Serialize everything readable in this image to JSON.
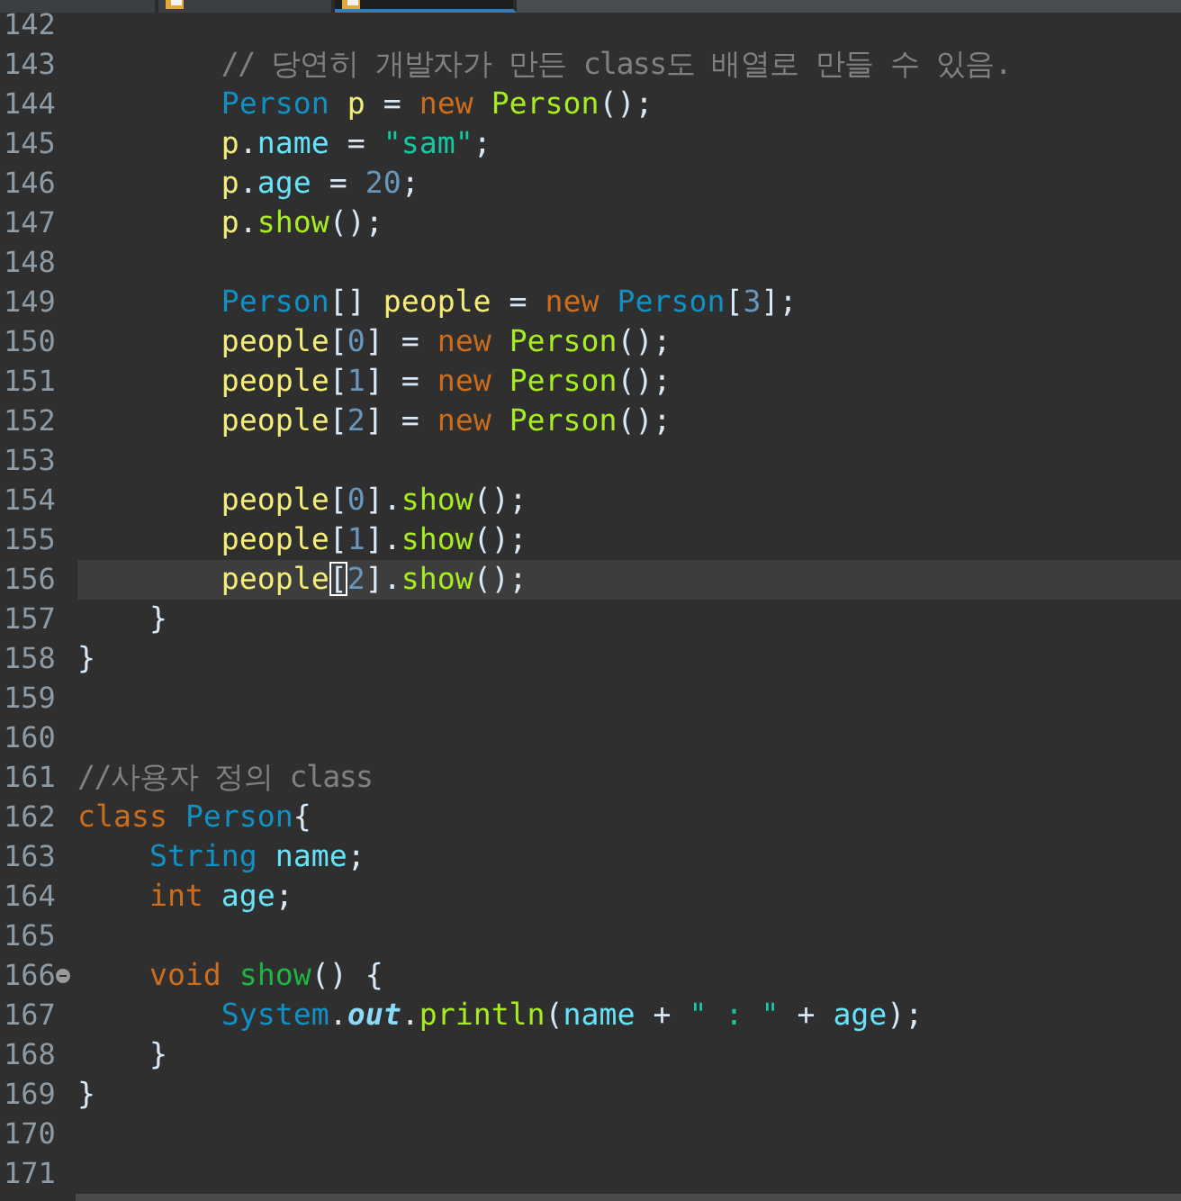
{
  "tabs": [
    {
      "selected": false
    },
    {
      "selected": false
    },
    {
      "selected": true
    }
  ],
  "lines": [
    {
      "number": "142",
      "current": false,
      "fold": false
    },
    {
      "number": "143",
      "current": false,
      "fold": false,
      "kind": "method",
      "tokens": [
        {
          "kind": "comment",
          "text": "// 당연히 개발자가 만든 class도 배열로 만들 수 있음."
        }
      ]
    },
    {
      "number": "144",
      "current": false,
      "fold": false,
      "kind": "method",
      "tokens": [
        {
          "kind": "type",
          "text": "Person"
        },
        {
          "kind": "local",
          "text": " p"
        },
        {
          "kind": "plain",
          "text": " = "
        },
        {
          "kind": "keyword",
          "text": "new"
        },
        {
          "kind": "method",
          "text": " Person"
        },
        {
          "kind": "plain",
          "text": "();"
        }
      ]
    },
    {
      "number": "145",
      "current": false,
      "fold": false,
      "kind": "method",
      "tokens": [
        {
          "kind": "local",
          "text": "p"
        },
        {
          "kind": "plain",
          "text": "."
        },
        {
          "kind": "field",
          "text": "name"
        },
        {
          "kind": "plain",
          "text": " = "
        },
        {
          "kind": "string",
          "text": "\"sam\""
        },
        {
          "kind": "plain",
          "text": ";"
        }
      ]
    },
    {
      "number": "146",
      "current": false,
      "fold": false,
      "kind": "method",
      "tokens": [
        {
          "kind": "local",
          "text": "p"
        },
        {
          "kind": "plain",
          "text": "."
        },
        {
          "kind": "field",
          "text": "age"
        },
        {
          "kind": "plain",
          "text": " = "
        },
        {
          "kind": "number",
          "text": "20"
        },
        {
          "kind": "plain",
          "text": ";"
        }
      ]
    },
    {
      "number": "147",
      "current": false,
      "fold": false,
      "kind": "method",
      "tokens": [
        {
          "kind": "local",
          "text": "p"
        },
        {
          "kind": "plain",
          "text": "."
        },
        {
          "kind": "method",
          "text": "show"
        },
        {
          "kind": "plain",
          "text": "();"
        }
      ]
    },
    {
      "number": "148",
      "current": false,
      "fold": false
    },
    {
      "number": "149",
      "current": false,
      "fold": false,
      "kind": "method",
      "tokens": [
        {
          "kind": "type",
          "text": "Person"
        },
        {
          "kind": "plain",
          "text": "[]"
        },
        {
          "kind": "local",
          "text": " people"
        },
        {
          "kind": "plain",
          "text": " = "
        },
        {
          "kind": "keyword",
          "text": "new"
        },
        {
          "kind": "type",
          "text": " Person"
        },
        {
          "kind": "plain",
          "text": "["
        },
        {
          "kind": "number",
          "text": "3"
        },
        {
          "kind": "plain",
          "text": "];"
        }
      ]
    },
    {
      "number": "150",
      "current": false,
      "fold": false,
      "kind": "method",
      "tokens": [
        {
          "kind": "local",
          "text": "people"
        },
        {
          "kind": "plain",
          "text": "["
        },
        {
          "kind": "number",
          "text": "0"
        },
        {
          "kind": "plain",
          "text": "] = "
        },
        {
          "kind": "keyword",
          "text": "new"
        },
        {
          "kind": "method",
          "text": " Person"
        },
        {
          "kind": "plain",
          "text": "();"
        }
      ]
    },
    {
      "number": "151",
      "current": false,
      "fold": false,
      "kind": "method",
      "tokens": [
        {
          "kind": "local",
          "text": "people"
        },
        {
          "kind": "plain",
          "text": "["
        },
        {
          "kind": "number",
          "text": "1"
        },
        {
          "kind": "plain",
          "text": "] = "
        },
        {
          "kind": "keyword",
          "text": "new"
        },
        {
          "kind": "method",
          "text": " Person"
        },
        {
          "kind": "plain",
          "text": "();"
        }
      ]
    },
    {
      "number": "152",
      "current": false,
      "fold": false,
      "kind": "method",
      "tokens": [
        {
          "kind": "local",
          "text": "people"
        },
        {
          "kind": "plain",
          "text": "["
        },
        {
          "kind": "number",
          "text": "2"
        },
        {
          "kind": "plain",
          "text": "] = "
        },
        {
          "kind": "keyword",
          "text": "new"
        },
        {
          "kind": "method",
          "text": " Person"
        },
        {
          "kind": "plain",
          "text": "();"
        }
      ]
    },
    {
      "number": "153",
      "current": false,
      "fold": false
    },
    {
      "number": "154",
      "current": false,
      "fold": false,
      "kind": "method",
      "tokens": [
        {
          "kind": "local",
          "text": "people"
        },
        {
          "kind": "plain",
          "text": "["
        },
        {
          "kind": "number",
          "text": "0"
        },
        {
          "kind": "plain",
          "text": "]."
        },
        {
          "kind": "method",
          "text": "show"
        },
        {
          "kind": "plain",
          "text": "();"
        }
      ]
    },
    {
      "number": "155",
      "current": false,
      "fold": false,
      "kind": "method",
      "tokens": [
        {
          "kind": "local",
          "text": "people"
        },
        {
          "kind": "plain",
          "text": "["
        },
        {
          "kind": "number",
          "text": "1"
        },
        {
          "kind": "plain",
          "text": "]."
        },
        {
          "kind": "method",
          "text": "show"
        },
        {
          "kind": "plain",
          "text": "();"
        }
      ]
    },
    {
      "number": "156",
      "current": true,
      "fold": false,
      "kind": "method",
      "tokens": [
        {
          "kind": "local",
          "text": "people"
        },
        {
          "kind": "plain",
          "text": "[",
          "caret": true
        },
        {
          "kind": "number",
          "text": "2"
        },
        {
          "kind": "plain",
          "text": "]."
        },
        {
          "kind": "method",
          "text": "show"
        },
        {
          "kind": "plain",
          "text": "();"
        }
      ]
    },
    {
      "number": "157",
      "current": false,
      "fold": false,
      "kind": "class",
      "tokens": [
        {
          "kind": "plain",
          "text": "}"
        }
      ]
    },
    {
      "number": "158",
      "current": false,
      "fold": false,
      "tokens": [
        {
          "kind": "plain",
          "text": "}"
        }
      ]
    },
    {
      "number": "159",
      "current": false,
      "fold": false
    },
    {
      "number": "160",
      "current": false,
      "fold": false
    },
    {
      "number": "161",
      "current": false,
      "fold": false,
      "tokens": [
        {
          "kind": "comment",
          "text": "//사용자 정의 class"
        }
      ]
    },
    {
      "number": "162",
      "current": false,
      "fold": false,
      "tokens": [
        {
          "kind": "keyword",
          "text": "class"
        },
        {
          "kind": "type",
          "text": " Person"
        },
        {
          "kind": "plain",
          "text": "{"
        }
      ]
    },
    {
      "number": "163",
      "current": false,
      "fold": false,
      "kind": "class",
      "tokens": [
        {
          "kind": "type",
          "text": "String"
        },
        {
          "kind": "field",
          "text": " name"
        },
        {
          "kind": "plain",
          "text": ";"
        }
      ]
    },
    {
      "number": "164",
      "current": false,
      "fold": false,
      "kind": "class",
      "tokens": [
        {
          "kind": "keyword",
          "text": "int"
        },
        {
          "kind": "field",
          "text": " age"
        },
        {
          "kind": "plain",
          "text": ";"
        }
      ]
    },
    {
      "number": "165",
      "current": false,
      "fold": false
    },
    {
      "number": "166",
      "current": false,
      "fold": true,
      "kind": "class",
      "tokens": [
        {
          "kind": "keyword",
          "text": "void"
        },
        {
          "kind": "declaration",
          "text": " show"
        },
        {
          "kind": "plain",
          "text": "() {"
        }
      ]
    },
    {
      "number": "167",
      "current": false,
      "fold": false,
      "kind": "method",
      "tokens": [
        {
          "kind": "type",
          "text": "System"
        },
        {
          "kind": "plain",
          "text": "."
        },
        {
          "kind": "static",
          "text": "out"
        },
        {
          "kind": "plain",
          "text": "."
        },
        {
          "kind": "method",
          "text": "println"
        },
        {
          "kind": "plain",
          "text": "("
        },
        {
          "kind": "field",
          "text": "name"
        },
        {
          "kind": "plain",
          "text": " + "
        },
        {
          "kind": "string",
          "text": "\" : \""
        },
        {
          "kind": "plain",
          "text": " + "
        },
        {
          "kind": "field",
          "text": "age"
        },
        {
          "kind": "plain",
          "text": ");"
        }
      ]
    },
    {
      "number": "168",
      "current": false,
      "fold": false,
      "kind": "class",
      "tokens": [
        {
          "kind": "plain",
          "text": "}"
        }
      ]
    },
    {
      "number": "169",
      "current": false,
      "fold": false,
      "tokens": [
        {
          "kind": "plain",
          "text": "}"
        }
      ]
    },
    {
      "number": "170",
      "current": false,
      "fold": false
    },
    {
      "number": "171",
      "current": false,
      "fold": false
    }
  ]
}
